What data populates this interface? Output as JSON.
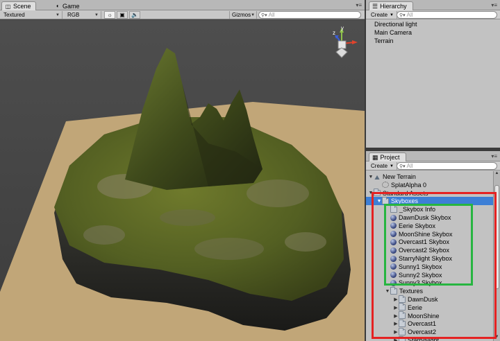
{
  "scene_tabs": [
    {
      "label": "Scene",
      "icon": "scene-icon",
      "active": true
    },
    {
      "label": "Game",
      "icon": "game-pacman-icon",
      "active": false
    }
  ],
  "scene_toolbar": {
    "render_mode": "Textured",
    "color_mode": "RGB",
    "gizmos_label": "Gizmos",
    "search_placeholder": "All",
    "toggles": [
      "lighting-toggle",
      "image-toggle",
      "audio-toggle"
    ]
  },
  "gizmo": {
    "y_axis": "y",
    "z_axis": "z",
    "x_axis": "x"
  },
  "hierarchy": {
    "title": "Hierarchy",
    "create_label": "Create",
    "search_placeholder": "All",
    "items": [
      "Directional light",
      "Main Camera",
      "Terrain"
    ]
  },
  "project": {
    "title": "Project",
    "create_label": "Create",
    "search_placeholder": "All",
    "items": [
      {
        "label": "New Terrain",
        "icon": "terrain-icon",
        "fold": "open",
        "indent": 0
      },
      {
        "label": "SplatAlpha 0",
        "icon": "splat-icon",
        "fold": "",
        "indent": 1
      },
      {
        "label": "Standard Assets",
        "icon": "folder-icon",
        "fold": "open",
        "indent": 0
      },
      {
        "label": "Skyboxes",
        "icon": "folder-icon",
        "fold": "open",
        "indent": 1,
        "selected": true
      },
      {
        "label": "_Skybox Info",
        "icon": "folder-icon",
        "fold": "",
        "indent": 2
      },
      {
        "label": "DawnDusk Skybox",
        "icon": "skybox-icon",
        "fold": "",
        "indent": 2
      },
      {
        "label": "Eerie Skybox",
        "icon": "skybox-icon",
        "fold": "",
        "indent": 2
      },
      {
        "label": "MoonShine Skybox",
        "icon": "skybox-icon",
        "fold": "",
        "indent": 2
      },
      {
        "label": "Overcast1 Skybox",
        "icon": "skybox-icon",
        "fold": "",
        "indent": 2
      },
      {
        "label": "Overcast2 Skybox",
        "icon": "skybox-icon",
        "fold": "",
        "indent": 2
      },
      {
        "label": "StarryNight Skybox",
        "icon": "skybox-icon",
        "fold": "",
        "indent": 2
      },
      {
        "label": "Sunny1 Skybox",
        "icon": "skybox-icon",
        "fold": "",
        "indent": 2
      },
      {
        "label": "Sunny2 Skybox",
        "icon": "skybox-icon",
        "fold": "",
        "indent": 2
      },
      {
        "label": "Sunny3 Skybox",
        "icon": "skybox-icon",
        "fold": "",
        "indent": 2
      },
      {
        "label": "Textures",
        "icon": "folder-icon",
        "fold": "open",
        "indent": 2
      },
      {
        "label": "DawnDusk",
        "icon": "folder-icon",
        "fold": "closed",
        "indent": 3
      },
      {
        "label": "Eerie",
        "icon": "folder-icon",
        "fold": "closed",
        "indent": 3
      },
      {
        "label": "MoonShine",
        "icon": "folder-icon",
        "fold": "closed",
        "indent": 3
      },
      {
        "label": "Overcast1",
        "icon": "folder-icon",
        "fold": "closed",
        "indent": 3
      },
      {
        "label": "Overcast2",
        "icon": "folder-icon",
        "fold": "closed",
        "indent": 3
      },
      {
        "label": "StarryNight",
        "icon": "folder-icon",
        "fold": "closed",
        "indent": 3
      }
    ]
  },
  "annotation_colors": {
    "red_box": "#e52222",
    "green_box": "#27b540",
    "selection": "#3d7fd6"
  }
}
